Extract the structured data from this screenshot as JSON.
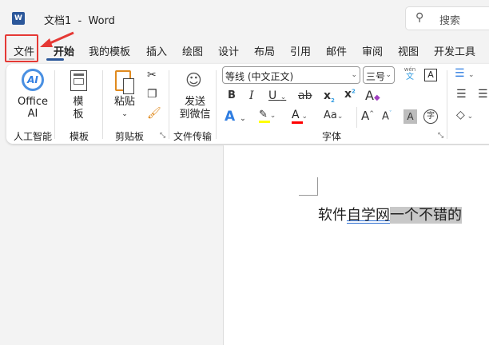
{
  "titlebar": {
    "title": "文档1  -  Word",
    "search_placeholder": "搜索"
  },
  "tabs": [
    "文件",
    "开始",
    "我的模板",
    "插入",
    "绘图",
    "设计",
    "布局",
    "引用",
    "邮件",
    "审阅",
    "视图",
    "开发工具"
  ],
  "ribbon": {
    "ai": {
      "label1": "Office",
      "label2": "AI",
      "group": "人工智能"
    },
    "template": {
      "label1": "模",
      "label2": "板",
      "group": "模板"
    },
    "clipboard": {
      "paste": "粘贴",
      "group": "剪贴板"
    },
    "transfer": {
      "label1": "发送",
      "label2": "到微信",
      "group": "文件传输"
    },
    "font": {
      "name": "等线 (中文正文)",
      "size": "三号",
      "group": "字体",
      "pinyin_top": "wén",
      "pinyin_bottom": "文"
    }
  },
  "document": {
    "text_plain": "软件",
    "text_link": "自学网",
    "text_selected": "一个不错的"
  },
  "colors": {
    "highlight": "#ffff00",
    "font_color": "#ff0000",
    "accent": "#2b579a",
    "callout": "#e53935"
  }
}
